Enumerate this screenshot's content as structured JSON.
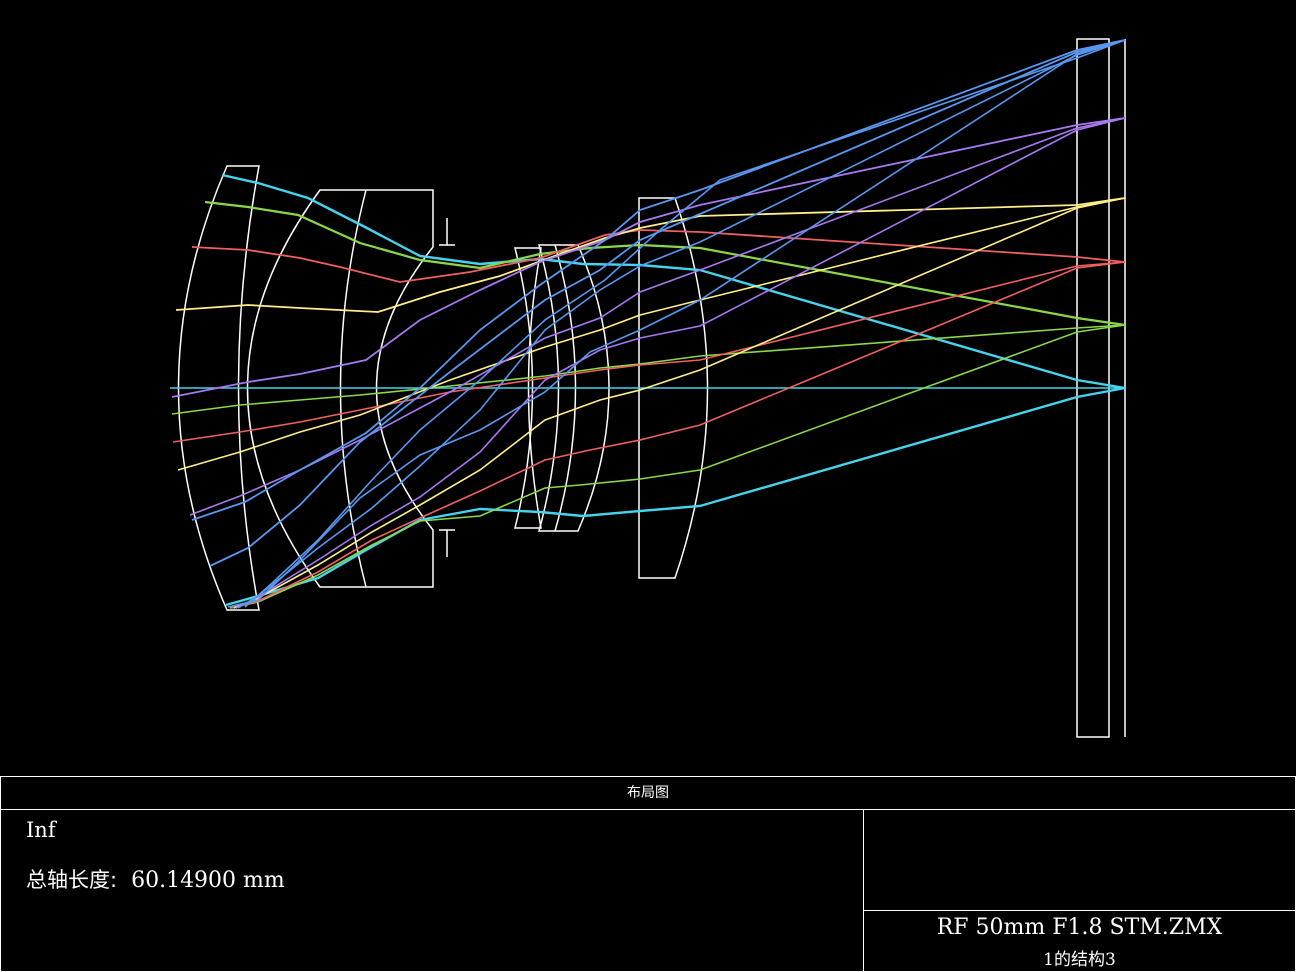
{
  "title": "布局图",
  "info": {
    "field_label": "Inf",
    "axis_length_label": "总轴长度:",
    "axis_length_value": "60.14900 mm"
  },
  "file": {
    "name": "RF 50mm F1.8 STM.ZMX",
    "config": "1的结构3"
  },
  "colors": {
    "background": "#000000",
    "element_outline": "#ffffff",
    "field_1": "#44d4ee",
    "field_2": "#8ad84a",
    "field_3": "#f06060",
    "field_4": "#ffee88",
    "field_5": "#a878f0",
    "field_6": "#5898f0"
  }
}
